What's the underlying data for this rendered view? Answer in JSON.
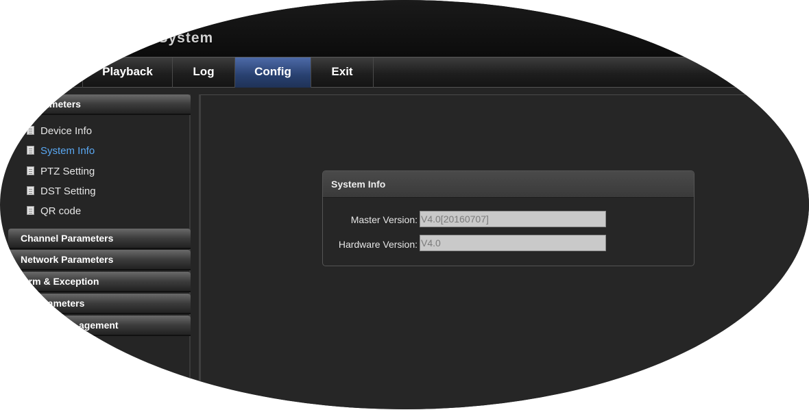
{
  "header": {
    "title": "ng System"
  },
  "nav": {
    "items": [
      {
        "label": "Playback"
      },
      {
        "label": "Log"
      },
      {
        "label": "Config",
        "active": true
      },
      {
        "label": "Exit"
      }
    ]
  },
  "sidebar": {
    "sections": [
      {
        "label": "c Parameters",
        "expanded": true
      },
      {
        "label": "Channel Parameters"
      },
      {
        "label": "Network Parameters"
      },
      {
        "label": "larm & Exception"
      },
      {
        "label": "nt Parameters"
      },
      {
        "label": "agement"
      }
    ],
    "items": [
      {
        "label": "Device Info",
        "icon": "document-icon"
      },
      {
        "label": "System Info",
        "icon": "document-icon",
        "selected": true
      },
      {
        "label": "PTZ Setting",
        "icon": "document-icon"
      },
      {
        "label": "DST Setting",
        "icon": "document-icon"
      },
      {
        "label": "QR code",
        "icon": "document-icon"
      }
    ]
  },
  "panel": {
    "title": "System Info",
    "fields": [
      {
        "label": "Master Version:",
        "value": "V4.0[20160707]"
      },
      {
        "label": "Hardware Version:",
        "value": "V4.0"
      }
    ]
  },
  "colors": {
    "background": "#252525",
    "nav_active": "#2f4a80",
    "selected_text": "#5aa8f2",
    "frame": "#ffffff"
  }
}
